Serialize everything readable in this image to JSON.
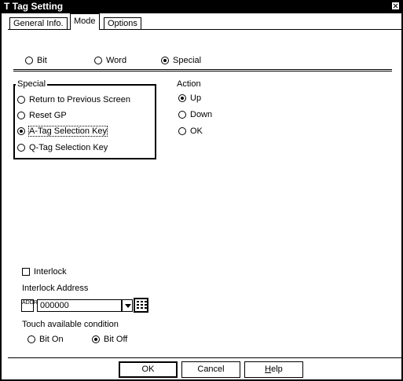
{
  "window": {
    "title": "T Tag Setting"
  },
  "tabs": [
    {
      "label": "General Info."
    },
    {
      "label": "Mode",
      "active": true
    },
    {
      "label": "Options"
    }
  ],
  "mode": {
    "options": [
      {
        "label": "Bit",
        "selected": false
      },
      {
        "label": "Word",
        "selected": false
      },
      {
        "label": "Special",
        "selected": true
      }
    ]
  },
  "special": {
    "legend": "Special",
    "options": [
      {
        "label": "Return to Previous Screen",
        "selected": false
      },
      {
        "label": "Reset GP",
        "selected": false
      },
      {
        "label": "A-Tag Selection Key",
        "selected": true
      },
      {
        "label": "Q-Tag Selection Key",
        "selected": false
      }
    ]
  },
  "action": {
    "label": "Action",
    "options": [
      {
        "label": "Up",
        "selected": true
      },
      {
        "label": "Down",
        "selected": false
      },
      {
        "label": "OK",
        "selected": false
      }
    ]
  },
  "interlock": {
    "checkbox_label": "Interlock",
    "checked": false,
    "address_label": "Interlock Address",
    "icon_text": "ADDR",
    "address_value": "000000",
    "touch_label": "Touch available condition",
    "touch_options": [
      {
        "label": "Bit On",
        "selected": false
      },
      {
        "label": "Bit Off",
        "selected": true
      }
    ]
  },
  "buttons": {
    "ok": "OK",
    "cancel": "Cancel",
    "help_mnemonic": "H",
    "help_rest": "elp"
  }
}
